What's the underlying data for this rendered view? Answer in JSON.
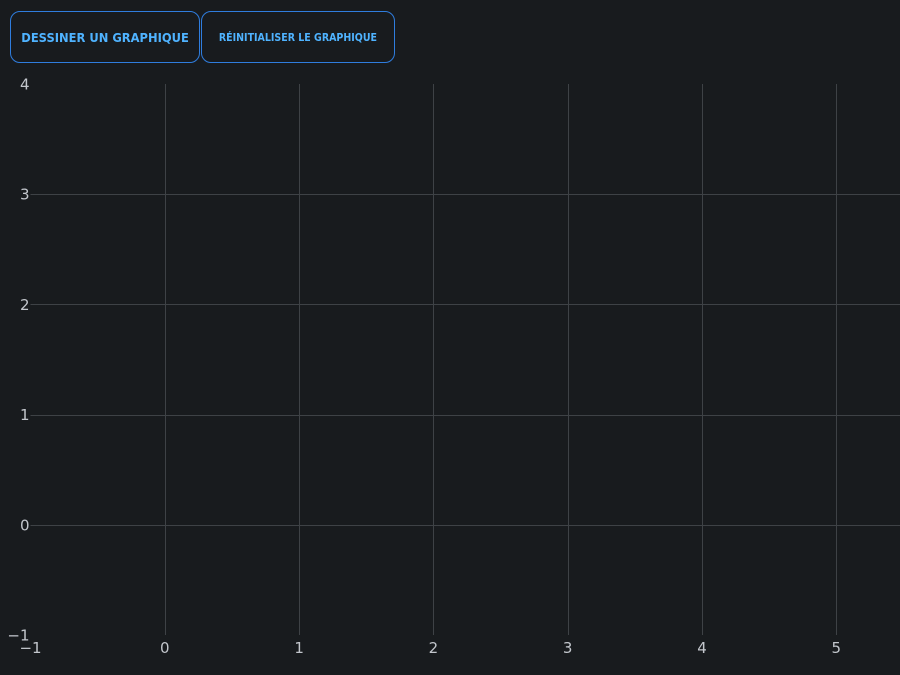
{
  "toolbar": {
    "draw_label": "DESSINER UN GRAPHIQUE",
    "reset_label": "RÉINITIALISER LE GRAPHIQUE"
  },
  "colors": {
    "background": "#181b1e",
    "grid": "#3e4246",
    "tick_label": "#c2c6cc",
    "button_border": "#2f7dde",
    "button_text": "#4fb3ff"
  },
  "chart_data": {
    "type": "line",
    "title": "",
    "xlabel": "",
    "ylabel": "",
    "series": [],
    "xlim": [
      -1,
      5.5
    ],
    "ylim": [
      -1,
      4
    ],
    "x_ticks": [
      -1,
      0,
      1,
      2,
      3,
      4,
      5
    ],
    "y_ticks": [
      -1,
      0,
      1,
      2,
      3,
      4
    ],
    "x_tick_labels": [
      "−1",
      "0",
      "1",
      "2",
      "3",
      "4",
      "5"
    ],
    "y_tick_labels": [
      "−1",
      "0",
      "1",
      "2",
      "3",
      "4"
    ],
    "grid": true,
    "legend": "none"
  }
}
